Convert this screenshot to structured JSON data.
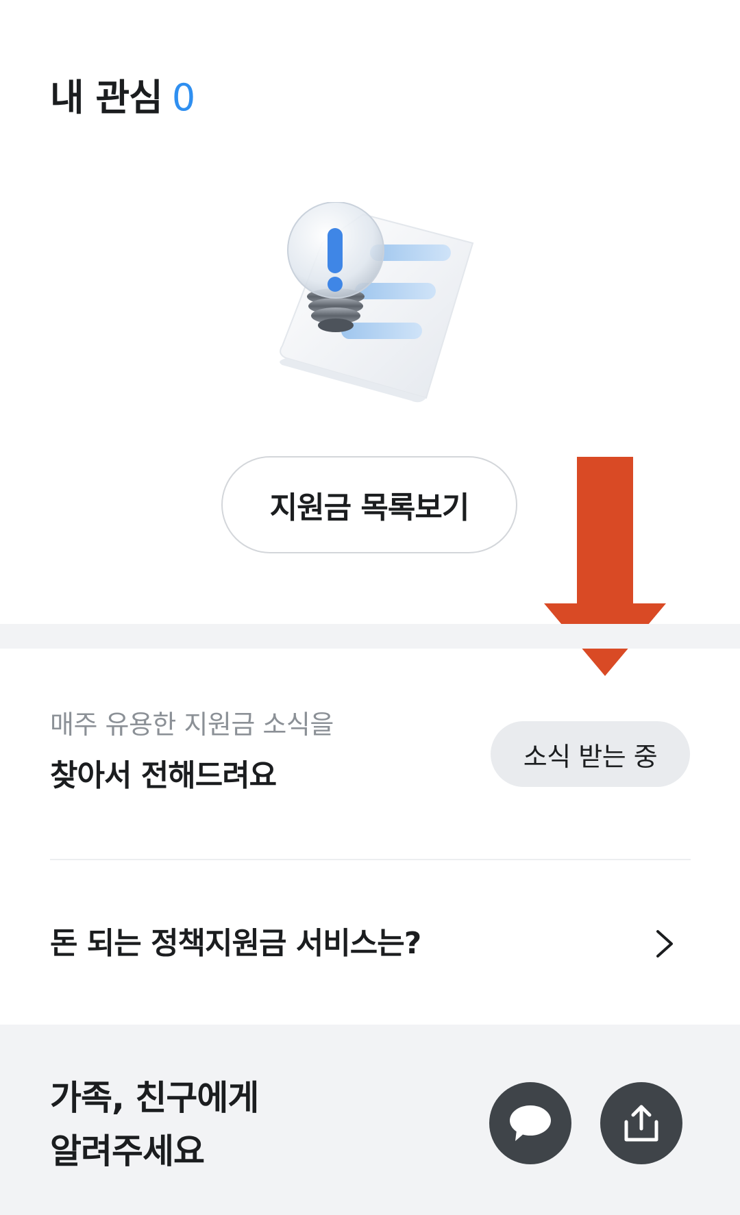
{
  "header": {
    "title": "내 관심",
    "count": "0"
  },
  "browse": {
    "label": "지원금 목록보기"
  },
  "subscribe": {
    "subtitle": "매주 유용한 지원금 소식을",
    "title": "찾아서 전해드려요",
    "button_label": "소식 받는 중"
  },
  "policy": {
    "label": "돈 되는 정책지원금 서비스는?"
  },
  "share": {
    "line1": "가족, 친구에게",
    "line2": "알려주세요"
  },
  "icons": {
    "illustration": "lightbulb-document-icon",
    "annotation": "red-down-arrow",
    "chevron": "chevron-right-icon",
    "chat": "chat-bubble-icon",
    "share": "share-upload-icon"
  },
  "colors": {
    "accent": "#2f8ff0",
    "annotation": "#d94a25",
    "dark_button": "#3f4449",
    "section_bg": "#f2f3f5",
    "chip_bg": "#e9ebee"
  }
}
